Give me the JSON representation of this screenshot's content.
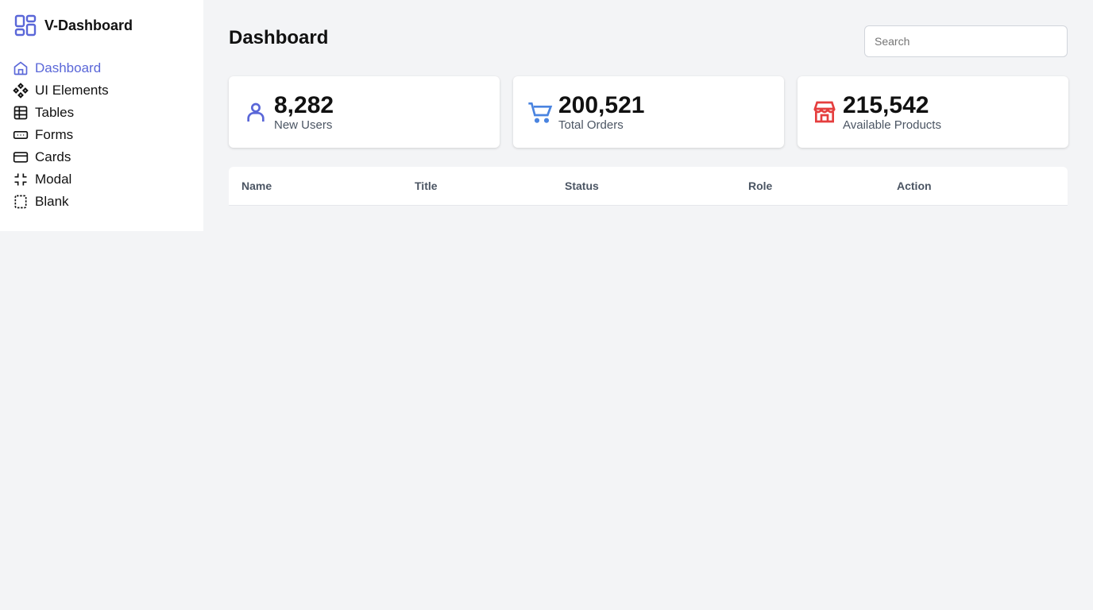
{
  "brand": {
    "name": "V-Dashboard"
  },
  "sidebar": {
    "items": [
      {
        "label": "Dashboard",
        "icon": "home-icon"
      },
      {
        "label": "UI Elements",
        "icon": "components-icon"
      },
      {
        "label": "Tables",
        "icon": "table-icon"
      },
      {
        "label": "Forms",
        "icon": "form-icon"
      },
      {
        "label": "Cards",
        "icon": "card-icon"
      },
      {
        "label": "Modal",
        "icon": "modal-icon"
      },
      {
        "label": "Blank",
        "icon": "blank-icon"
      }
    ]
  },
  "header": {
    "title": "Dashboard",
    "search_placeholder": "Search"
  },
  "stats": [
    {
      "value": "8,282",
      "label": "New Users",
      "color": "#5a67d8"
    },
    {
      "value": "200,521",
      "label": "Total Orders",
      "color": "#4a84e0"
    },
    {
      "value": "215,542",
      "label": "Available Products",
      "color": "#e53e3e"
    }
  ],
  "table": {
    "columns": [
      "Name",
      "Title",
      "Status",
      "Role",
      "Action"
    ]
  }
}
